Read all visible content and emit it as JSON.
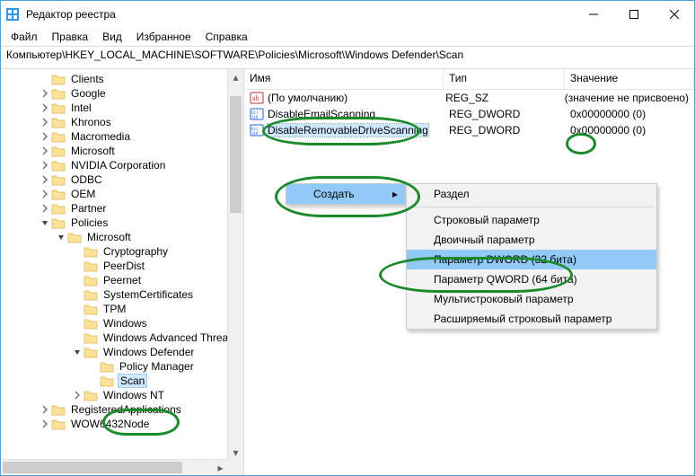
{
  "window": {
    "title": "Редактор реестра"
  },
  "menu": {
    "file": "Файл",
    "edit": "Правка",
    "view": "Вид",
    "fav": "Избранное",
    "help": "Справка"
  },
  "address": "Компьютер\\HKEY_LOCAL_MACHINE\\SOFTWARE\\Policies\\Microsoft\\Windows Defender\\Scan",
  "cols": {
    "name": "Имя",
    "type": "Тип",
    "value": "Значение"
  },
  "tree": [
    {
      "d": 2,
      "t": 0,
      "l": "Clients"
    },
    {
      "d": 2,
      "t": 1,
      "l": "Google"
    },
    {
      "d": 2,
      "t": 1,
      "l": "Intel"
    },
    {
      "d": 2,
      "t": 1,
      "l": "Khronos"
    },
    {
      "d": 2,
      "t": 1,
      "l": "Macromedia"
    },
    {
      "d": 2,
      "t": 1,
      "l": "Microsoft"
    },
    {
      "d": 2,
      "t": 1,
      "l": "NVIDIA Corporation"
    },
    {
      "d": 2,
      "t": 1,
      "l": "ODBC"
    },
    {
      "d": 2,
      "t": 1,
      "l": "OEM"
    },
    {
      "d": 2,
      "t": 1,
      "l": "Partner"
    },
    {
      "d": 2,
      "t": 2,
      "l": "Policies"
    },
    {
      "d": 3,
      "t": 2,
      "l": "Microsoft"
    },
    {
      "d": 4,
      "t": 0,
      "l": "Cryptography"
    },
    {
      "d": 4,
      "t": 0,
      "l": "PeerDist"
    },
    {
      "d": 4,
      "t": 0,
      "l": "Peernet"
    },
    {
      "d": 4,
      "t": 0,
      "l": "SystemCertificates"
    },
    {
      "d": 4,
      "t": 0,
      "l": "TPM"
    },
    {
      "d": 4,
      "t": 0,
      "l": "Windows"
    },
    {
      "d": 4,
      "t": 0,
      "l": "Windows Advanced Threa"
    },
    {
      "d": 4,
      "t": 2,
      "l": "Windows Defender"
    },
    {
      "d": 5,
      "t": 0,
      "l": "Policy Manager"
    },
    {
      "d": 5,
      "t": 0,
      "l": "Scan",
      "sel": true
    },
    {
      "d": 4,
      "t": 1,
      "l": "Windows NT"
    },
    {
      "d": 2,
      "t": 1,
      "l": "RegisteredApplications"
    },
    {
      "d": 2,
      "t": 1,
      "l": "WOW6432Node"
    }
  ],
  "values": [
    {
      "icon": "str",
      "name": "(По умолчанию)",
      "type": "REG_SZ",
      "value": "(значение не присвоено)",
      "sel": false
    },
    {
      "icon": "bin",
      "name": "DisableEmailScanning",
      "type": "REG_DWORD",
      "value": "0x00000000 (0)",
      "sel": false
    },
    {
      "icon": "bin",
      "name": "DisableRemovableDriveScanning",
      "type": "REG_DWORD",
      "value": "0x00000000 (0)",
      "sel": true
    }
  ],
  "ctx1": {
    "create": "Создать"
  },
  "ctx2": {
    "key": "Раздел",
    "string": "Строковый параметр",
    "binary": "Двоичный параметр",
    "dword": "Параметр DWORD (32 бита)",
    "qword": "Параметр QWORD (64 бита)",
    "multi": "Мультистроковый параметр",
    "expand": "Расширяемый строковый параметр"
  }
}
